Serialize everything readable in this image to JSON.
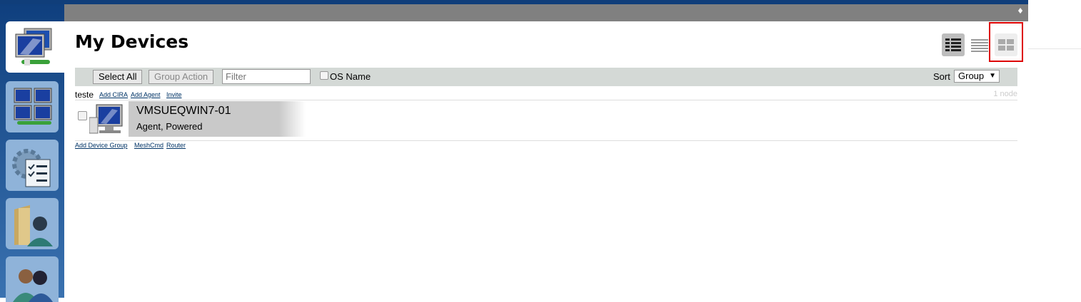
{
  "header": {
    "title": "My Devices",
    "menu_glyph": "♦"
  },
  "sidebar": {
    "items": [
      {
        "icon": "my-devices-icon",
        "active": true
      },
      {
        "icon": "device-groups-icon",
        "active": false
      },
      {
        "icon": "server-settings-icon",
        "active": false
      },
      {
        "icon": "my-files-icon",
        "active": false
      },
      {
        "icon": "my-users-icon",
        "active": false
      }
    ]
  },
  "views": {
    "items": [
      {
        "icon": "detailed-list-view-icon"
      },
      {
        "icon": "list-view-icon"
      },
      {
        "icon": "tile-view-icon",
        "highlighted": true
      }
    ]
  },
  "toolbar": {
    "select_all_label": "Select All",
    "group_action_label": "Group Action",
    "filter_placeholder": "Filter",
    "os_name_label": "OS Name",
    "sort_label": "Sort",
    "sort_value": "Group"
  },
  "group": {
    "name": "teste",
    "links": [
      "Add CIRA",
      "Add Agent",
      "Invite"
    ],
    "node_count": "1 node"
  },
  "devices": [
    {
      "name": "VMSUEQWIN7-01",
      "status": "Agent, Powered"
    }
  ],
  "footer_links": [
    "Add Device Group",
    "MeshCmd",
    "Router"
  ],
  "colors": {
    "header_blue": "#103e7a",
    "highlight": "#dd0000",
    "toolbar_bg": "#d4d9d6"
  }
}
